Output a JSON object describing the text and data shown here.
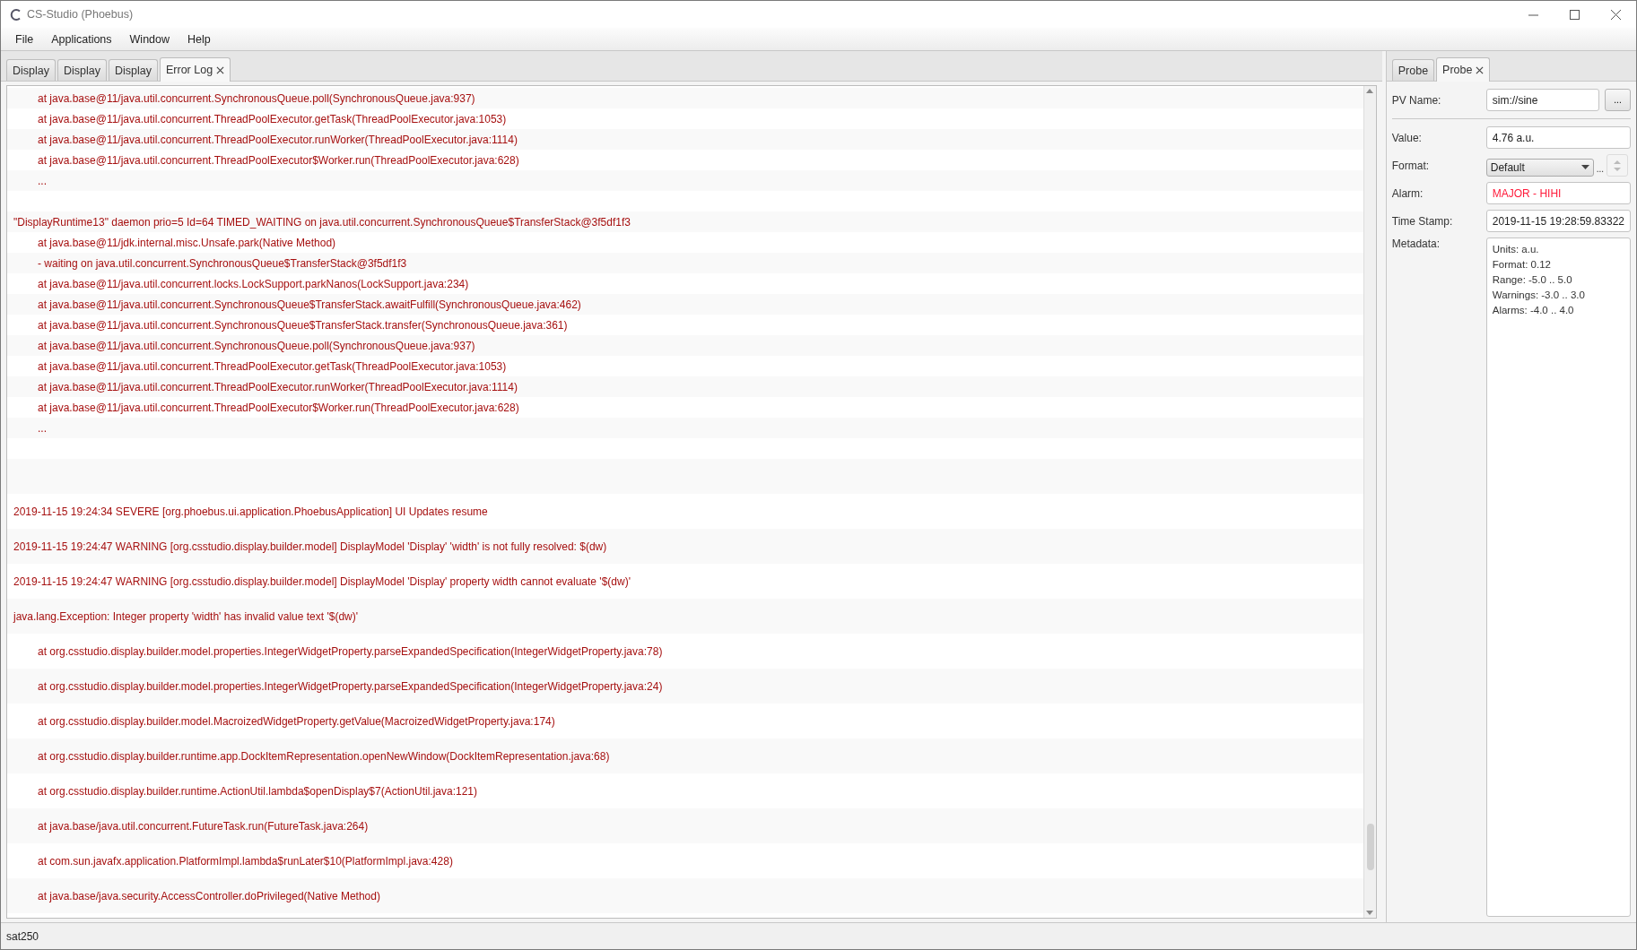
{
  "window": {
    "title": "CS-Studio (Phoebus)"
  },
  "menu": [
    "File",
    "Applications",
    "Window",
    "Help"
  ],
  "tabs": [
    {
      "label": "Display",
      "selected": false,
      "closable": false
    },
    {
      "label": "Display",
      "selected": false,
      "closable": false
    },
    {
      "label": "Display",
      "selected": false,
      "closable": false
    },
    {
      "label": "Error Log",
      "selected": true,
      "closable": true
    }
  ],
  "error_log": {
    "thread_dump": [
      {
        "kind": "frame",
        "text": "at java.base@11/java.util.concurrent.SynchronousQueue.poll(SynchronousQueue.java:937)"
      },
      {
        "kind": "frame",
        "text": "at java.base@11/java.util.concurrent.ThreadPoolExecutor.getTask(ThreadPoolExecutor.java:1053)"
      },
      {
        "kind": "frame",
        "text": "at java.base@11/java.util.concurrent.ThreadPoolExecutor.runWorker(ThreadPoolExecutor.java:1114)"
      },
      {
        "kind": "frame",
        "text": "at java.base@11/java.util.concurrent.ThreadPoolExecutor$Worker.run(ThreadPoolExecutor.java:628)"
      },
      {
        "kind": "frame",
        "text": "..."
      },
      {
        "kind": "blank"
      },
      {
        "kind": "message",
        "text": "\"DisplayRuntime13\" daemon prio=5 Id=64 TIMED_WAITING on java.util.concurrent.SynchronousQueue$TransferStack@3f5df1f3"
      },
      {
        "kind": "frame",
        "text": "at java.base@11/jdk.internal.misc.Unsafe.park(Native Method)"
      },
      {
        "kind": "frame",
        "text": "-  waiting on java.util.concurrent.SynchronousQueue$TransferStack@3f5df1f3"
      },
      {
        "kind": "frame",
        "text": "at java.base@11/java.util.concurrent.locks.LockSupport.parkNanos(LockSupport.java:234)"
      },
      {
        "kind": "frame",
        "text": "at java.base@11/java.util.concurrent.SynchronousQueue$TransferStack.awaitFulfill(SynchronousQueue.java:462)"
      },
      {
        "kind": "frame",
        "text": "at java.base@11/java.util.concurrent.SynchronousQueue$TransferStack.transfer(SynchronousQueue.java:361)"
      },
      {
        "kind": "frame",
        "text": "at java.base@11/java.util.concurrent.SynchronousQueue.poll(SynchronousQueue.java:937)"
      },
      {
        "kind": "frame",
        "text": "at java.base@11/java.util.concurrent.ThreadPoolExecutor.getTask(ThreadPoolExecutor.java:1053)"
      },
      {
        "kind": "frame",
        "text": "at java.base@11/java.util.concurrent.ThreadPoolExecutor.runWorker(ThreadPoolExecutor.java:1114)"
      },
      {
        "kind": "frame",
        "text": "at java.base@11/java.util.concurrent.ThreadPoolExecutor$Worker.run(ThreadPoolExecutor.java:628)"
      },
      {
        "kind": "frame",
        "text": "..."
      },
      {
        "kind": "blank"
      }
    ],
    "entries": [
      {
        "kind": "blank"
      },
      {
        "kind": "message",
        "text": "2019-11-15 19:24:34 SEVERE [org.phoebus.ui.application.PhoebusApplication] UI Updates resume"
      },
      {
        "kind": "message",
        "text": "2019-11-15 19:24:47 WARNING [org.csstudio.display.builder.model] DisplayModel 'Display' 'width' is not fully resolved: $(dw)"
      },
      {
        "kind": "message",
        "text": "2019-11-15 19:24:47 WARNING [org.csstudio.display.builder.model] DisplayModel 'Display' property width cannot evaluate '$(dw)'"
      },
      {
        "kind": "message",
        "text": "java.lang.Exception: Integer property 'width' has invalid value text '$(dw)'"
      },
      {
        "kind": "frame",
        "text": "at org.csstudio.display.builder.model.properties.IntegerWidgetProperty.parseExpandedSpecification(IntegerWidgetProperty.java:78)"
      },
      {
        "kind": "frame",
        "text": "at org.csstudio.display.builder.model.properties.IntegerWidgetProperty.parseExpandedSpecification(IntegerWidgetProperty.java:24)"
      },
      {
        "kind": "frame",
        "text": "at org.csstudio.display.builder.model.MacroizedWidgetProperty.getValue(MacroizedWidgetProperty.java:174)"
      },
      {
        "kind": "frame",
        "text": "at org.csstudio.display.builder.runtime.app.DockItemRepresentation.openNewWindow(DockItemRepresentation.java:68)"
      },
      {
        "kind": "frame",
        "text": "at org.csstudio.display.builder.runtime.ActionUtil.lambda$openDisplay$7(ActionUtil.java:121)"
      },
      {
        "kind": "frame",
        "text": "at java.base/java.util.concurrent.FutureTask.run(FutureTask.java:264)"
      },
      {
        "kind": "frame",
        "text": "at com.sun.javafx.application.PlatformImpl.lambda$runLater$10(PlatformImpl.java:428)"
      },
      {
        "kind": "frame",
        "text": "at java.base/java.security.AccessController.doPrivileged(Native Method)"
      }
    ]
  },
  "probe": {
    "tabs": [
      {
        "label": "Probe",
        "selected": false,
        "closable": false
      },
      {
        "label": "Probe",
        "selected": true,
        "closable": true
      }
    ],
    "pv_name": {
      "label": "PV Name:",
      "value": "sim://sine",
      "button": "..."
    },
    "fields": [
      {
        "kind": "text",
        "label": "Value:",
        "value": "4.76 a.u.",
        "alarm": false
      },
      {
        "kind": "combo",
        "label": "Format:",
        "value": "Default",
        "extra": "..."
      },
      {
        "kind": "text",
        "label": "Alarm:",
        "value": "MAJOR - HIHI",
        "alarm": true
      },
      {
        "kind": "text",
        "label": "Time Stamp:",
        "value": "2019-11-15 19:28:59.83322",
        "alarm": false
      },
      {
        "kind": "multiline",
        "label": "Metadata:",
        "lines": [
          "Units: a.u.",
          "Format: 0.12",
          "Range: -5.0 .. 5.0",
          "Warnings: -3.0 .. 3.0",
          "Alarms: -4.0 .. 4.0"
        ]
      }
    ]
  },
  "status_bar": "sat250"
}
